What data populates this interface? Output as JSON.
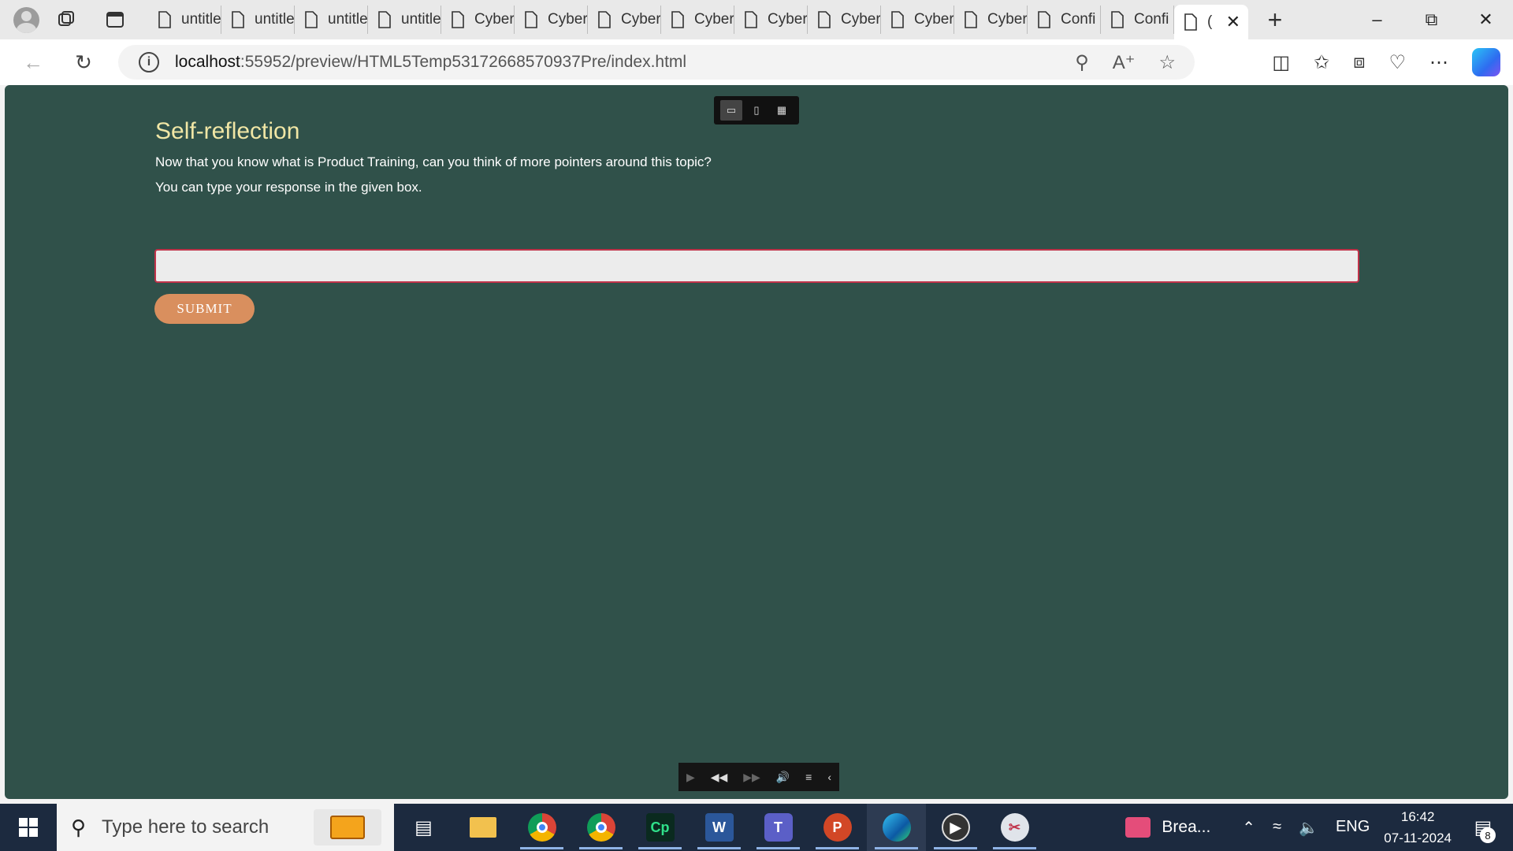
{
  "browser": {
    "tabs": [
      {
        "label": "untitled",
        "active": false
      },
      {
        "label": "untitled",
        "active": false
      },
      {
        "label": "untitled",
        "active": false
      },
      {
        "label": "untitled",
        "active": false
      },
      {
        "label": "Cyber",
        "active": false
      },
      {
        "label": "Cyber",
        "active": false
      },
      {
        "label": "Cyber",
        "active": false
      },
      {
        "label": "Cyber",
        "active": false
      },
      {
        "label": "Cyber",
        "active": false
      },
      {
        "label": "Cyber",
        "active": false
      },
      {
        "label": "Cyber",
        "active": false
      },
      {
        "label": "Cyber",
        "active": false
      },
      {
        "label": "Confi",
        "active": false
      },
      {
        "label": "Confi",
        "active": false
      },
      {
        "label": "(",
        "active": true
      }
    ],
    "url_host": "localhost",
    "url_rest": ":55952/preview/HTML5Temp53172668570937Pre/index.html"
  },
  "page": {
    "title": "Self-reflection",
    "line1": "Now that you know what is Product Training, can you think of more pointers around this topic?",
    "line2": "You can type your response in the given box.",
    "response_value": "",
    "submit_label": "SUBMIT"
  },
  "taskbar": {
    "search_placeholder": "Type here to search",
    "running_app": "Brea...",
    "lang": "ENG",
    "time": "16:42",
    "date": "07-11-2024",
    "notification_count": "8"
  },
  "colors": {
    "content_bg": "#30514a",
    "title": "#f0e6a5",
    "submit_bg": "#d98f5e",
    "input_border": "#c0334a",
    "taskbar_bg": "#1c2a3f"
  }
}
